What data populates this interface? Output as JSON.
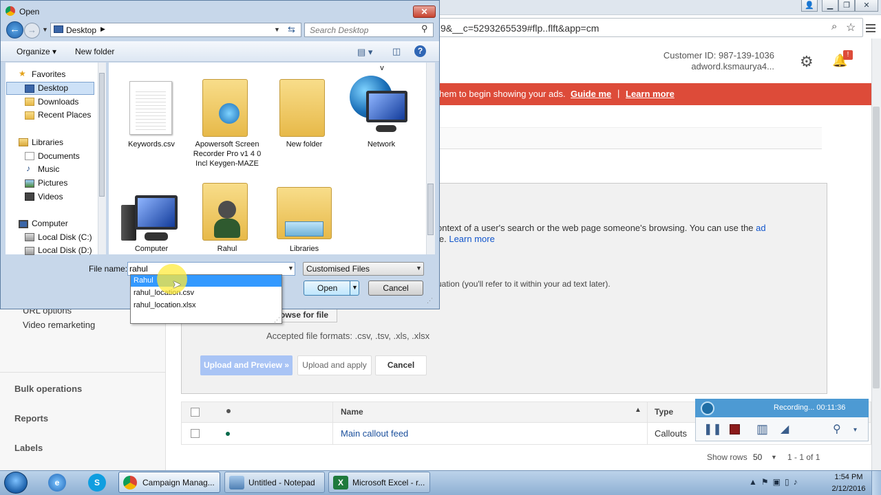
{
  "browser": {
    "url": "9&__c=5293265539#flp..flft&app=cm",
    "customer_id": "Customer ID: 987-139-1036",
    "account": "adword.ksmaurya4...",
    "notification_count": "!",
    "alert": {
      "text": "hem to begin showing your ads.",
      "guide_me": "Guide me",
      "separator": "|",
      "learn_more": "Learn more"
    },
    "description_line1_a": "ontext of a user's search or the web page someone's browsing. You can use the ",
    "description_line1_link": "ad",
    "description_line2_a": "le. ",
    "description_line2_link": "Learn more",
    "description_line3": "uation (you'll refer to it within your ad text later).",
    "browse_button": "rowse for file",
    "accepted_formats": "Accepted file formats: .csv, .tsv, .xls, .xlsx",
    "upload_preview": "Upload and Preview »",
    "upload_apply": "Upload and apply",
    "cancel": "Cancel",
    "left_nav": {
      "url_options": "URL options",
      "video_remarketing": "Video remarketing",
      "bulk_operations": "Bulk operations",
      "reports": "Reports",
      "labels": "Labels"
    },
    "table": {
      "col_name": "Name",
      "col_type": "Type",
      "rows": [
        {
          "name": "Main callout feed",
          "type": "Callouts"
        }
      ],
      "show_rows_label": "Show rows",
      "show_rows_value": "50",
      "range": "1 - 1 of 1"
    },
    "recorder": {
      "status": "Recording... 00:11:36"
    }
  },
  "dialog": {
    "title": "Open",
    "close_label": "✕",
    "address_location": "Desktop",
    "search_placeholder": "Search Desktop",
    "organize": "Organize ▾",
    "new_folder": "New folder",
    "nav_items": {
      "favorites": "Favorites",
      "desktop": "Desktop",
      "downloads": "Downloads",
      "recent_places": "Recent Places",
      "libraries": "Libraries",
      "documents": "Documents",
      "music": "Music",
      "pictures": "Pictures",
      "videos": "Videos",
      "computer": "Computer",
      "local_c": "Local Disk (C:)",
      "local_d": "Local Disk (D:)"
    },
    "files": [
      {
        "label": "Keywords.csv"
      },
      {
        "label": "Apowersoft Screen Recorder Pro v1 4 0 Incl Keygen-MAZE"
      },
      {
        "label": "New folder"
      },
      {
        "label": "Network"
      },
      {
        "label": "Computer"
      },
      {
        "label": "Rahul"
      },
      {
        "label": "Libraries"
      }
    ],
    "top_cut_label": "v",
    "file_name_label": "File name:",
    "file_name_value": "rahul",
    "file_type": "Customised Files",
    "open_button": "Open",
    "cancel_button": "Cancel",
    "autocomplete": [
      "Rahul",
      "rahul_location.csv",
      "rahul_location.xlsx"
    ]
  },
  "taskbar": {
    "tasks": [
      {
        "label": "Campaign Manag..."
      },
      {
        "label": "Untitled - Notepad"
      },
      {
        "label": "Microsoft Excel - r..."
      }
    ],
    "time": "1:54 PM",
    "date": "2/12/2016"
  }
}
